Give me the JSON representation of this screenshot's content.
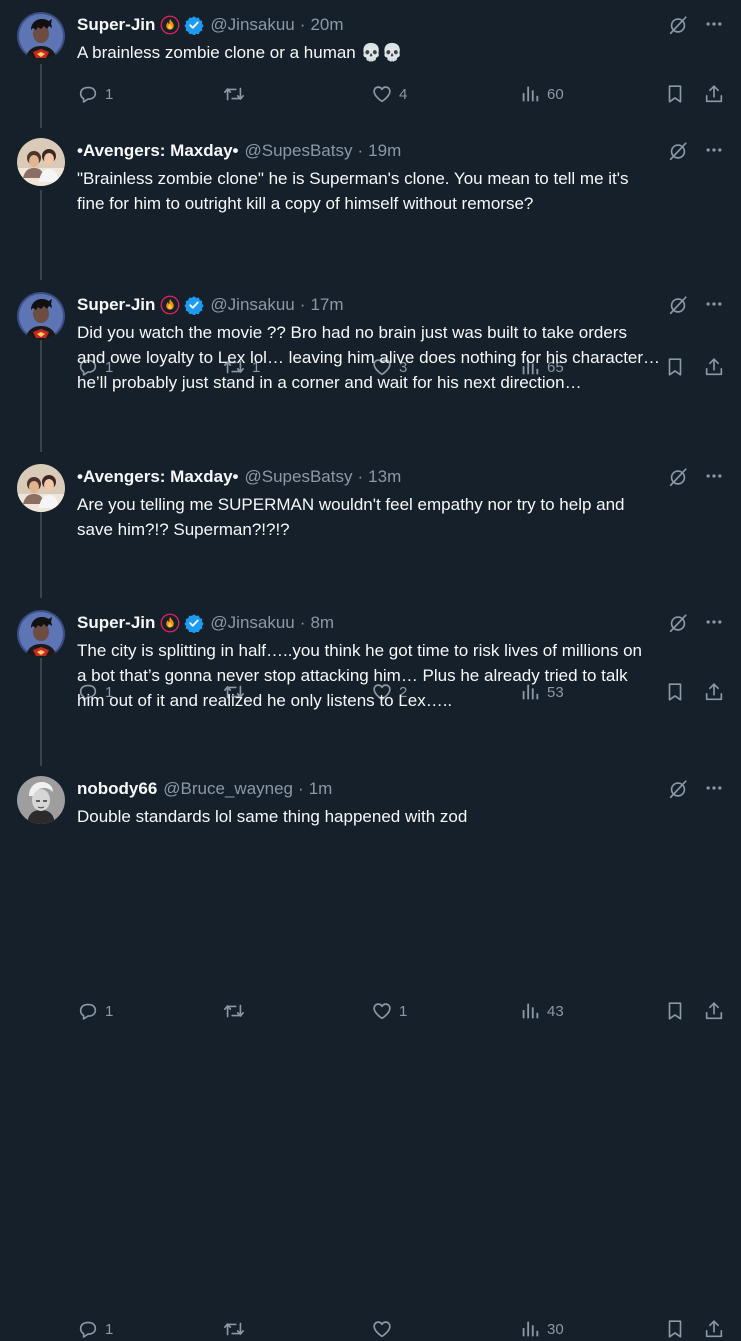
{
  "tweets": [
    {
      "name": "Super-Jin",
      "handle": "@Jinsakuu",
      "time": "20m",
      "text": [
        "A brainless zombie clone or a human 💀💀"
      ],
      "replies": "1",
      "retweets": "",
      "likes": "4",
      "views": "60",
      "avatar": "superjin",
      "emoji": true,
      "verified": true
    },
    {
      "name": "•Avengers: Maxday•",
      "handle": "@SupesBatsy",
      "time": "19m",
      "text": [
        "\"Brainless zombie clone\" he is Superman's clone. You mean to tell me it's",
        "fine for him to outright kill a copy of himself without remorse?"
      ],
      "replies": "1",
      "retweets": "1",
      "likes": "3",
      "views": "65",
      "avatar": "maxday",
      "emoji": false,
      "verified": false
    },
    {
      "name": "Super-Jin",
      "handle": "@Jinsakuu",
      "time": "17m",
      "text": [
        "Did you watch the movie ?? Bro had no brain just was built to take orders",
        "and owe loyalty to Lex lol… leaving him alive does nothing for his character…",
        "he’ll probably just stand in a corner and wait for his next direction…"
      ],
      "replies": "1",
      "retweets": "",
      "likes": "2",
      "views": "53",
      "avatar": "superjin",
      "emoji": true,
      "verified": true
    },
    {
      "name": "•Avengers: Maxday•",
      "handle": "@SupesBatsy",
      "time": "13m",
      "text": [
        "Are you telling me SUPERMAN wouldn't feel empathy nor try to help and",
        "save him?!? Superman?!?!?"
      ],
      "replies": "1",
      "retweets": "",
      "likes": "1",
      "views": "43",
      "avatar": "maxday",
      "emoji": false,
      "verified": false
    },
    {
      "name": "Super-Jin",
      "handle": "@Jinsakuu",
      "time": "8m",
      "text": [
        "The city is splitting in half…..you think he got time to risk lives of millions on",
        "a bot that’s gonna never stop attacking him… Plus he already tried to talk",
        "him out of it and realized he only listens to Lex….."
      ],
      "replies": "1",
      "retweets": "",
      "likes": "",
      "views": "30",
      "avatar": "superjin",
      "emoji": true,
      "verified": true
    },
    {
      "name": "nobody66",
      "handle": "@Bruce_wayneg",
      "time": "1m",
      "text": [
        "Double standards lol same thing happened with zod"
      ],
      "avatar": "nobody",
      "emoji": false,
      "verified": false
    }
  ],
  "separator": "·",
  "colors": {
    "background": "#15202b",
    "text": "#f7f9f9",
    "muted": "#8b98a5",
    "verified": "#1d9bf0",
    "thread_line": "#38444d"
  },
  "icons": [
    "reply-icon",
    "retweet-icon",
    "like-icon",
    "views-icon",
    "bookmark-icon",
    "share-icon",
    "grok-icon",
    "more-icon",
    "verified-badge-icon",
    "fire-emoji-icon"
  ]
}
